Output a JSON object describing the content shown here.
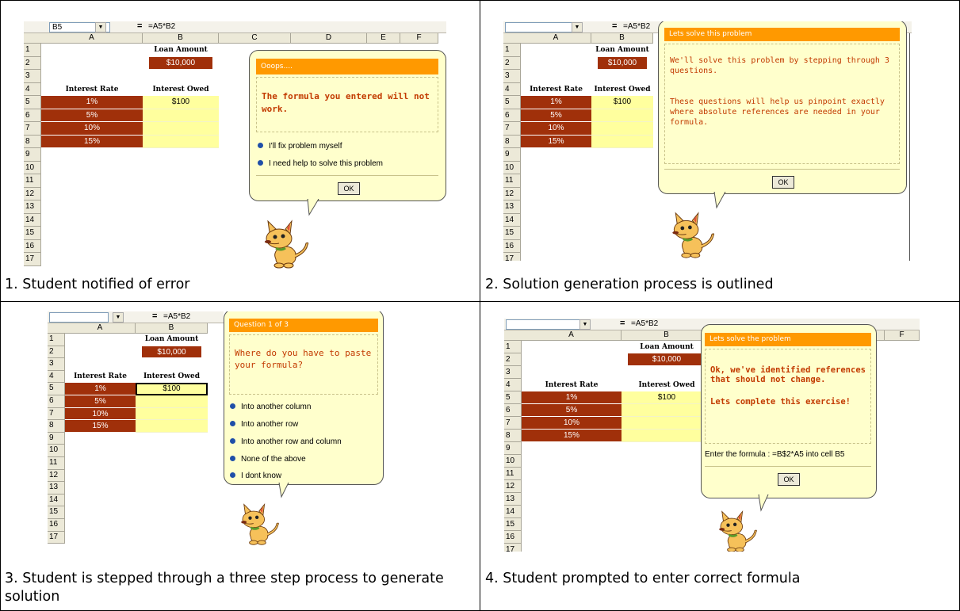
{
  "captions": [
    "1. Student notified of error",
    "2. Solution generation process is outlined",
    "3. Student is stepped through a three step process to generate solution",
    "4. Student prompted to enter correct formula"
  ],
  "sheet": {
    "columns": [
      "A",
      "B",
      "C",
      "D",
      "E",
      "F"
    ],
    "rows": [
      "1",
      "2",
      "3",
      "4",
      "5",
      "6",
      "7",
      "8",
      "9",
      "10",
      "11",
      "12",
      "13",
      "14",
      "15",
      "16",
      "17"
    ],
    "loan_amount_label": "Loan Amount",
    "loan_amount_value": "$10,000",
    "interest_rate_label": "Interest Rate",
    "interest_owed_label": "Interest Owed",
    "rates": [
      "1%",
      "5%",
      "10%",
      "15%"
    ],
    "first_owed": "$100",
    "cell_ref": "B5",
    "equals": "=",
    "formula": "=A5*B2"
  },
  "panel1": {
    "title": "Ooops....",
    "message": "The formula you entered will not work.",
    "options": [
      "I'll fix problem myself",
      "I need help to solve this problem"
    ],
    "ok_label": "OK"
  },
  "panel2": {
    "title": "Lets solve this problem",
    "message1": "We'll solve this problem by stepping through 3 questions.",
    "message2": "These questions will help us pinpoint exactly where absolute references are needed in your formula.",
    "ok_label": "OK"
  },
  "panel3": {
    "title": "Question 1 of 3",
    "message": "Where do you have to paste your formula?",
    "options": [
      "Into another column",
      "Into another row",
      "Into another row and column",
      "None of the above",
      "I dont know"
    ]
  },
  "panel4": {
    "title": "Lets solve the problem",
    "message1": "Ok, we've identified references that should not change.",
    "message2": "Lets complete this exercise!",
    "instruction": "Enter the formula : =B$2*A5 into cell B5",
    "ok_label": "OK"
  },
  "colors": {
    "title_bar": "#ff9900",
    "balloon_bg": "#ffffcc",
    "rate_cell": "#a0300a",
    "owed_cell": "#ffff9e",
    "message_text": "#c23a00"
  }
}
